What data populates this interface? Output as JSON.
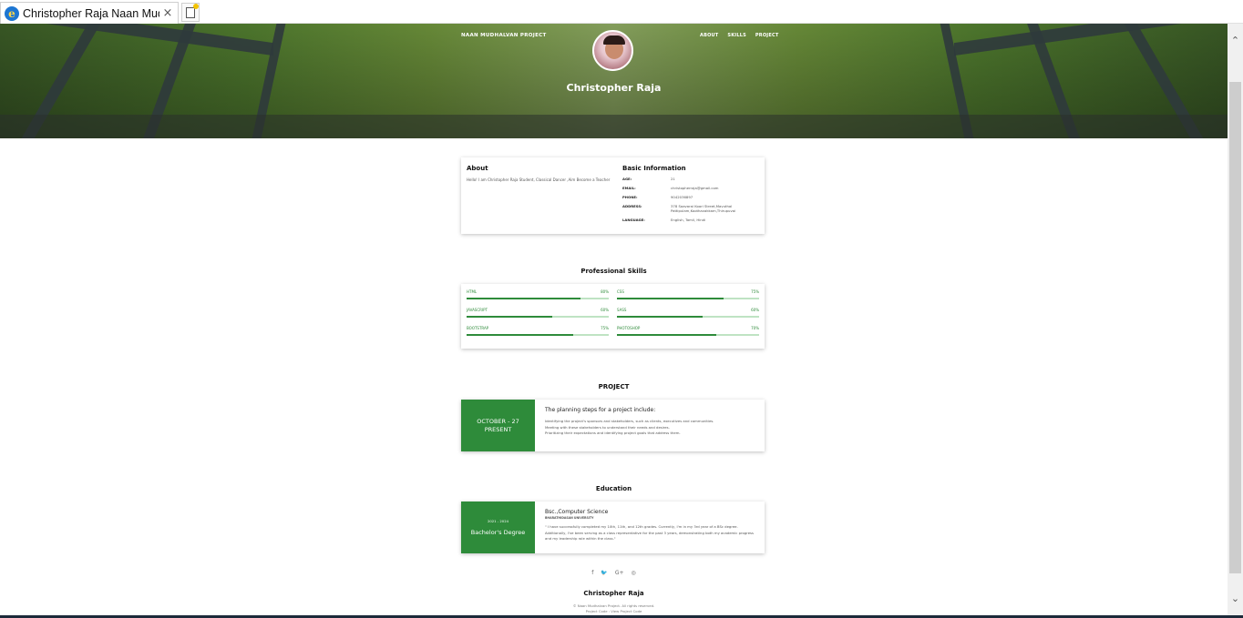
{
  "browser": {
    "tab_title": "Christopher Raja Naan Mud...",
    "close_glyph": "×"
  },
  "hero": {
    "brand": "NAAN MUDHALVAN PROJECT",
    "nav": [
      "ABOUT",
      "SKILLS",
      "PROJECT"
    ],
    "name": "Christopher Raja"
  },
  "about": {
    "heading": "About",
    "text": "Hello! I am Christopher Raja Student, Classical Dancer ,Aim Become a Teacher",
    "info_heading": "Basic Information",
    "info": [
      {
        "k": "AGE:",
        "v": "21"
      },
      {
        "k": "EMAIL:",
        "v": "christopherraja@gmail.com"
      },
      {
        "k": "PHONE:",
        "v": "9042036897"
      },
      {
        "k": "ADDRESS:",
        "v": "378 Saavarai Koori Street,Mavuthal Pattipulam,Koothavakkam,Thirupuvai"
      },
      {
        "k": "LANGUAGE:",
        "v": "English, Tamil, Hindi"
      }
    ]
  },
  "skills": {
    "heading": "Professional Skills",
    "items": [
      {
        "name": "HTML",
        "pct_label": "80%",
        "level": 0.8
      },
      {
        "name": "CSS",
        "pct_label": "75%",
        "level": 0.75
      },
      {
        "name": "JAVASCRIPT",
        "pct_label": "60%",
        "level": 0.6
      },
      {
        "name": "SASS",
        "pct_label": "60%",
        "level": 0.6
      },
      {
        "name": "BOOTSTRAP",
        "pct_label": "75%",
        "level": 0.75
      },
      {
        "name": "PHOTOSHOP",
        "pct_label": "70%",
        "level": 0.7
      }
    ]
  },
  "project": {
    "heading": "PROJECT",
    "date": "OCTOBER - 27 PRESENT",
    "title": "The planning steps for a project include:",
    "lines": [
      "Identifying the project's sponsors and stakeholders, such as clients, executives and communities.",
      "Meeting with these stakeholders to understand their needs and desires.",
      "Prioritizing their expectations and identifying project goals that address them."
    ]
  },
  "education": {
    "heading": "Education",
    "years": "2021 - 2024",
    "degree": "Bachelor's Degree",
    "title": "Bsc.,Computer Science",
    "institution": "BHARATHIDASAN UNIVERSITY",
    "text": "\" I have successfully completed my 10th, 11th, and 12th grades. Currently, I'm in my 3rd year of a BSc degree. Additionally, I've been serving as a class representative for the past 3 years, demonstrating both my academic progress and my leadership role within the class.\""
  },
  "footer": {
    "social_icons": [
      "facebook-icon",
      "twitter-icon",
      "google-plus-icon",
      "instagram-icon"
    ],
    "social_glyphs": [
      "f",
      "🐦",
      "G+",
      "◎"
    ],
    "name": "Christopher Raja",
    "copyright": "© Naan Mudhalvan Project. All rights reserved.",
    "links": "Project Code : View Project Code"
  },
  "scroll": {
    "up": "⌃",
    "down": "⌄"
  },
  "colors": {
    "accent": "#2e8b3a",
    "accent_light": "#bfe3c3"
  }
}
